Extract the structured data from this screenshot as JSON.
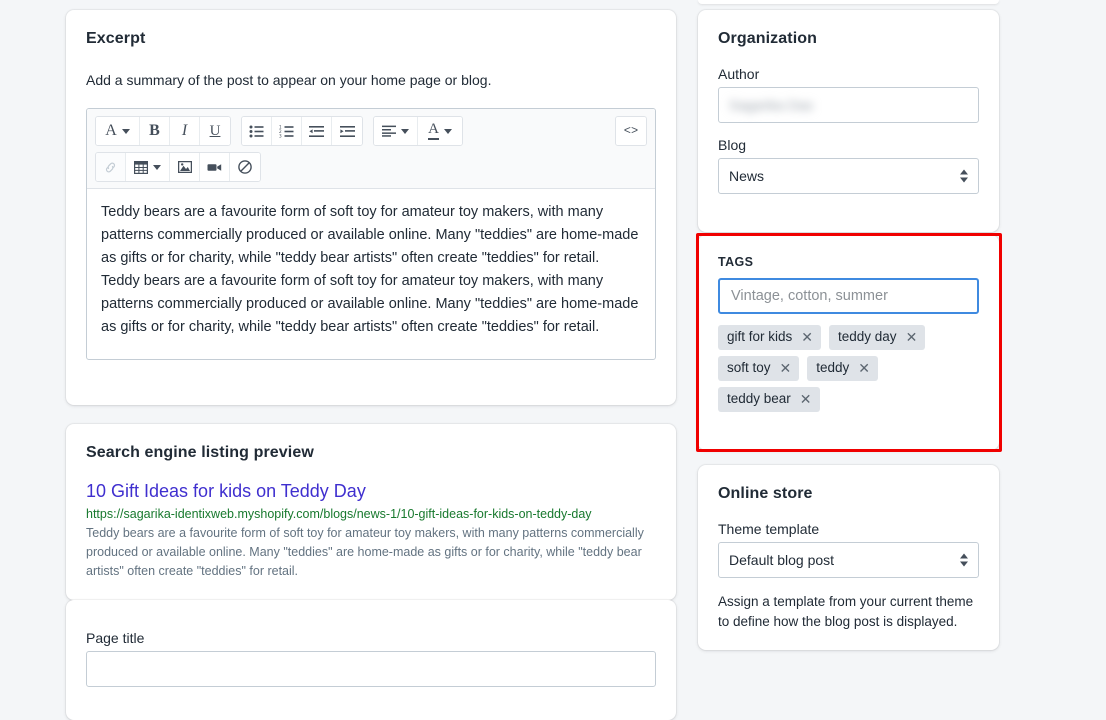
{
  "excerpt": {
    "title": "Excerpt",
    "helper": "Add a summary of the post to appear on your home page or blog.",
    "toolbar": {
      "font_style_icon": "font-style-icon",
      "bold_icon": "bold-icon",
      "italic_icon": "italic-icon",
      "underline_icon": "underline-icon",
      "bulleted_list_icon": "bulleted-list-icon",
      "numbered_list_icon": "numbered-list-icon",
      "outdent_icon": "outdent-icon",
      "indent_icon": "indent-icon",
      "align_icon": "align-left-icon",
      "text_color_icon": "text-color-icon",
      "code_icon": "<>",
      "link_icon": "link-icon",
      "table_icon": "table-icon",
      "image_icon": "image-icon",
      "video_icon": "video-icon",
      "clear_formatting_icon": "clear-formatting-icon",
      "glyph_font": "A",
      "glyph_bold": "B",
      "glyph_italic": "I",
      "glyph_underline": "U",
      "glyph_color": "A"
    },
    "body": "Teddy bears are a favourite form of soft toy for amateur toy makers, with many patterns commercially produced or available online. Many \"teddies\" are home-made as gifts or for charity, while \"teddy bear artists\" often create \"teddies\" for retail. Teddy bears are a favourite form of soft toy for amateur toy makers, with many patterns commercially produced or available online. Many \"teddies\" are home-made as gifts or for charity, while \"teddy bear artists\" often create \"teddies\" for retail."
  },
  "seo": {
    "title": "Search engine listing preview",
    "result_title": "10 Gift Ideas for kids on Teddy Day",
    "result_url": "https://sagarika-identixweb.myshopify.com/blogs/news-1/10-gift-ideas-for-kids-on-teddy-day",
    "result_description": "Teddy bears are a favourite form of soft toy for amateur toy makers, with many patterns commercially produced or available online. Many \"teddies\" are home-made as gifts or for charity, while \"teddy bear artists\" often create \"teddies\" for retail."
  },
  "page_title_section": {
    "label": "Page title",
    "value": ""
  },
  "organization": {
    "title": "Organization",
    "author_label": "Author",
    "author_value": "Sagarika Das",
    "author_redacted": true,
    "blog_label": "Blog",
    "blog_value": "News",
    "blog_options": [
      "News"
    ]
  },
  "tags": {
    "label": "TAGS",
    "placeholder": "Vintage, cotton, summer",
    "value": "",
    "chips": [
      {
        "label": "gift for kids",
        "remove": "✕"
      },
      {
        "label": "teddy day",
        "remove": "✕"
      },
      {
        "label": "soft toy",
        "remove": "✕"
      },
      {
        "label": "teddy",
        "remove": "✕"
      },
      {
        "label": "teddy bear",
        "remove": "✕"
      }
    ],
    "highlight_color": "#f00000",
    "focus_border_color": "#3f8ae0",
    "chip_background": "#dfe3e8"
  },
  "online_store": {
    "title": "Online store",
    "theme_template_label": "Theme template",
    "theme_template_value": "Default blog post",
    "theme_template_options": [
      "Default blog post"
    ],
    "note": "Assign a template from your current theme to define how the blog post is displayed."
  },
  "colors": {
    "page_background": "#f4f6f8",
    "card_background": "#ffffff",
    "text": "#212b36",
    "subdued_text": "#637381",
    "seo_title": "#3f2fcf",
    "seo_url": "#18792e"
  }
}
